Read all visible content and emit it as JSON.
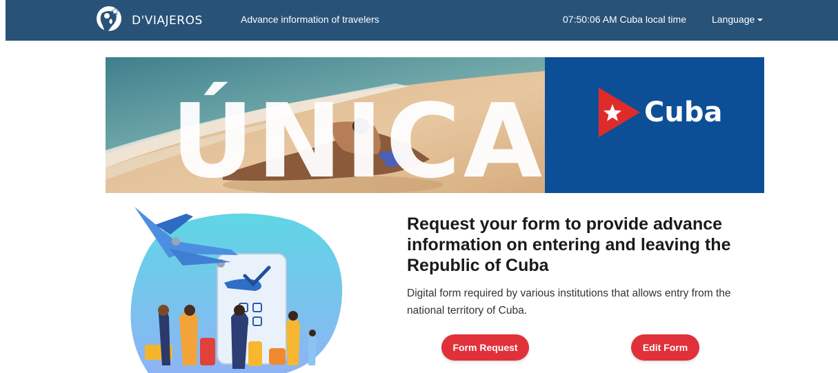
{
  "navbar": {
    "brand": "D'VIAJEROS",
    "tagline": "Advance information of travelers",
    "clock": "07:50:06 AM Cuba local time",
    "language_label": "Language"
  },
  "banner": {
    "headline": "ÚNICA",
    "country": "Cuba"
  },
  "hero": {
    "title": "Request your form to provide advance information on entering and leaving the Republic of Cuba",
    "description": "Digital form required by various institutions that allows entry from the national territory of Cuba.",
    "form_request_label": "Form Request",
    "edit_form_label": "Edit Form"
  },
  "colors": {
    "navbar": "#295278",
    "banner_blue": "#0d4f96",
    "button_red": "#e0313b",
    "cuba_star_red": "#e02b2b"
  },
  "icons": [
    "logo-icon",
    "caret-down-icon",
    "cuba-star-icon",
    "plane-icon",
    "checkmark-icon"
  ]
}
